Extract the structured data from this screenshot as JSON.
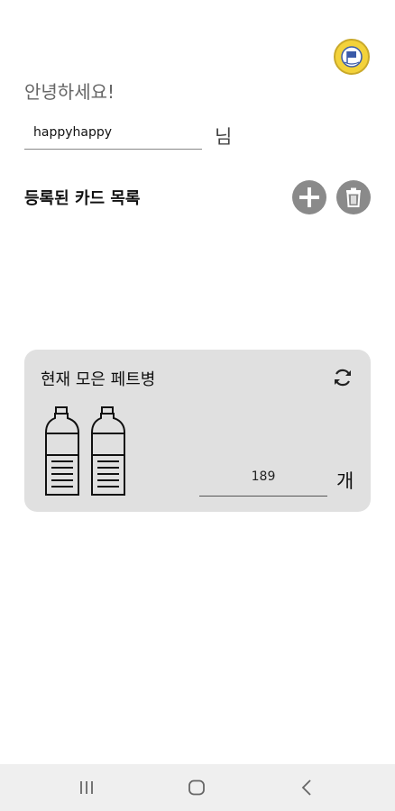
{
  "header": {
    "logo_icon": "club-emblem-icon",
    "greeting": "안녕하세요!"
  },
  "user": {
    "name_value": "happyhappy",
    "name_suffix": "님"
  },
  "cards": {
    "title": "등록된 카드 목록",
    "add_icon": "plus-icon",
    "delete_icon": "trash-icon"
  },
  "bottles": {
    "title": "현재 모은 페트병",
    "refresh_icon": "refresh-icon",
    "bottle_icon": "pet-bottle-icon",
    "count": "189",
    "unit": "개"
  },
  "navbar": {
    "recent_icon": "recent-apps-icon",
    "home_icon": "home-icon",
    "back_icon": "back-icon"
  },
  "colors": {
    "card_bg": "#e0e0e0",
    "button_bg": "#8a8a8a",
    "logo_yellow": "#f3d23a"
  }
}
